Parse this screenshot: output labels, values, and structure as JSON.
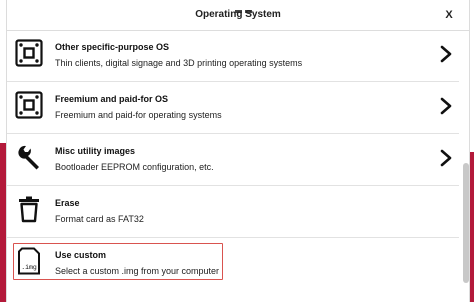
{
  "dialog": {
    "title": "Operating System",
    "close_label": "X"
  },
  "items": [
    {
      "title": "Other specific-purpose OS",
      "desc": "Thin clients, digital signage and 3D printing operating systems",
      "icon": "chip-board-icon",
      "has_submenu": true
    },
    {
      "title": "Freemium and paid-for OS",
      "desc": "Freemium and paid-for operating systems",
      "icon": "chip-board-icon",
      "has_submenu": true
    },
    {
      "title": "Misc utility images",
      "desc": "Bootloader EEPROM configuration, etc.",
      "icon": "wrench-icon",
      "has_submenu": true
    },
    {
      "title": "Erase",
      "desc": "Format card as FAT32",
      "icon": "trash-icon",
      "has_submenu": false
    },
    {
      "title": "Use custom",
      "desc": "Select a custom .img from your computer",
      "icon": "img-file-icon",
      "icon_text": ".img",
      "has_submenu": false
    }
  ],
  "colors": {
    "accent_red": "#b3193a",
    "highlight_border": "#d9534f"
  }
}
